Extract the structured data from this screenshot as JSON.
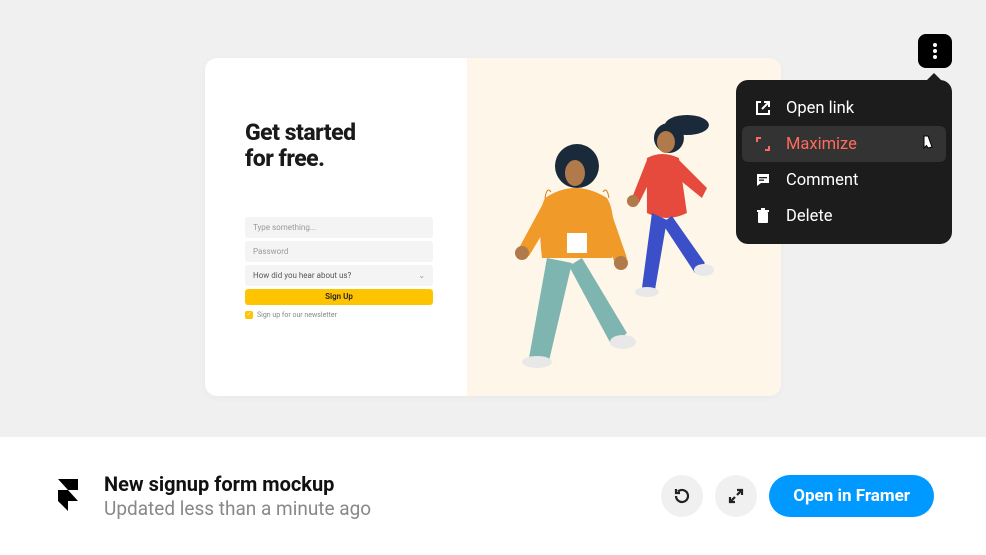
{
  "mockup": {
    "title_line1": "Get started",
    "title_line2": "for free.",
    "input_placeholder": "Type something...",
    "password_placeholder": "Password",
    "select_label": "How did you hear about us?",
    "signup_label": "Sign Up",
    "newsletter_label": "Sign up for our newsletter"
  },
  "menu": {
    "items": [
      {
        "icon": "open-link-icon",
        "label": "Open link"
      },
      {
        "icon": "maximize-icon",
        "label": "Maximize"
      },
      {
        "icon": "comment-icon",
        "label": "Comment"
      },
      {
        "icon": "delete-icon",
        "label": "Delete"
      }
    ]
  },
  "footer": {
    "title": "New signup form mockup",
    "subtitle": "Updated less than a minute ago",
    "primary_label": "Open in Framer"
  }
}
